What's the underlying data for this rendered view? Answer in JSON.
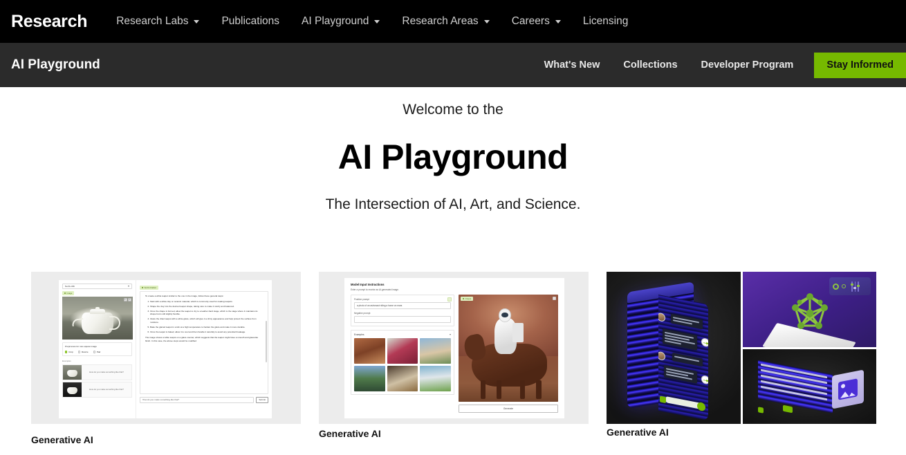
{
  "top_nav": {
    "brand": "Research",
    "items": [
      {
        "label": "Research Labs",
        "has_caret": true
      },
      {
        "label": "Publications",
        "has_caret": false
      },
      {
        "label": "AI Playground",
        "has_caret": true
      },
      {
        "label": "Research Areas",
        "has_caret": true
      },
      {
        "label": "Careers",
        "has_caret": true
      },
      {
        "label": "Licensing",
        "has_caret": false
      }
    ]
  },
  "sub_nav": {
    "title": "AI Playground",
    "items": [
      {
        "label": "What's New"
      },
      {
        "label": "Collections"
      },
      {
        "label": "Developer Program"
      }
    ],
    "cta": {
      "label": "Stay Informed",
      "color": "#76b900"
    }
  },
  "hero": {
    "eyebrow": "Welcome to the",
    "title": "AI Playground",
    "subtitle": "The Intersection of AI, Art, and Science."
  },
  "cards": [
    {
      "caption": "Generative AI",
      "demo": {
        "model_select": "NeVA-43b",
        "image_chip": "Image",
        "preprocess_label": "Preprocess for non-square image",
        "radios": [
          {
            "label": "Crop",
            "selected": true
          },
          {
            "label": "Resize",
            "selected": false
          },
          {
            "label": "Pad",
            "selected": false
          }
        ],
        "examples_label": "Examples",
        "example_rows": [
          "How do you make something like that?",
          "How do you make something like that?"
        ],
        "chat_chip": "NeVA Chatbot",
        "chat_intro": "To create a white teapot similar to the one in the image, follow these general steps:",
        "chat_steps": [
          "Start with a white clay or ceramic material, which is commonly used for making teapots.",
          "Shape the clay into the desired teapot shape, taking care to make it sturdy and balanced.",
          "Once the shape is formed, allow the teapot to dry to a leather-hard stage, which is the stage where it maintains its shape but is still slightly flexible.",
          "Glaze the dried teapot with a white glaze, which will give it a shiny appearance and help protect the surface from moisture.",
          "Bake the glazed teapot in a kiln at a high temperature to harden the glaze and make it more durable.",
          "Once the teapot is baked, allow it to cool and then handle it carefully to avoid any potential breakage."
        ],
        "chat_outro": "The image shows a white teapot on a glass counter, which suggests that the teapot might have a smooth and glass-like finish. In this case, the above steps would be modified",
        "input_placeholder": "How do you make something like that?",
        "submit_label": "Submit"
      }
    },
    {
      "caption": "Generative AI",
      "demo": {
        "heading": "Model Input Instructions",
        "subheading": "Enter a prompt to receive an AI-generated image.",
        "positive_label": "Positive prompt",
        "positive_value": "a photo of an astronaut riding a horse on mars",
        "negative_label": "Negative prompt",
        "negative_value": "",
        "examples_label": "Examples",
        "output_chip": "Output",
        "generate_label": "Generate"
      }
    },
    {
      "caption": "Generative AI",
      "demo": {
        "alt": "3D rendered collage of a chat interface server, a green molecular mesh on a white slab, and a document-to-image illustration"
      }
    }
  ]
}
